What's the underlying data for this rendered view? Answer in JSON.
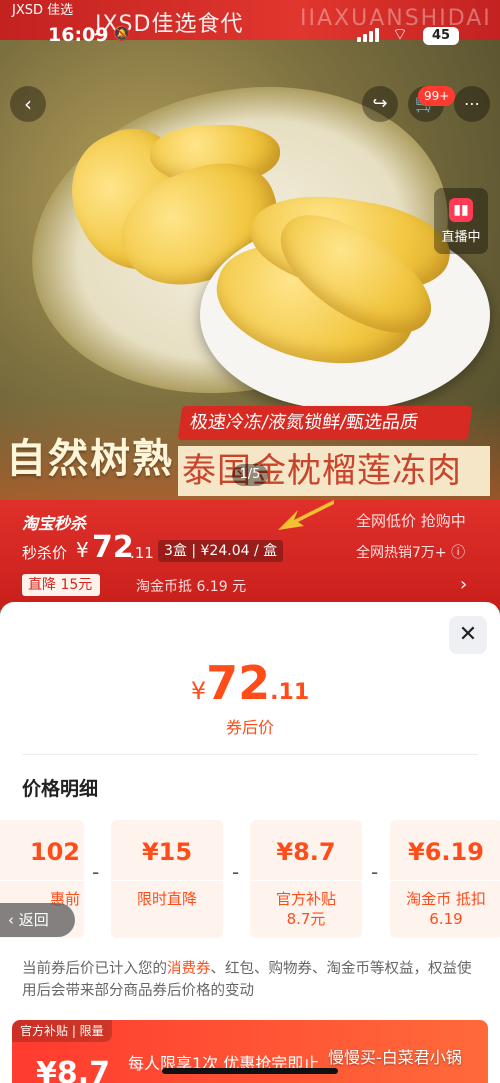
{
  "status_bar": {
    "time": "16:09",
    "battery": "45"
  },
  "hero": {
    "brand_badge": "JXSD 佳选",
    "brand_title": "JXSD佳选食代",
    "brand_faded": "IIAXUANSHIDAI",
    "cart_count": "99+",
    "live_label": "直播中",
    "promo_strip": "极速冷冻/液氮锁鲜/甄选品质",
    "promo_left": "自然树熟",
    "promo_right": "泰国金枕榴莲冻肉",
    "pager": "1/5"
  },
  "price_band": {
    "logo": "淘宝秒杀",
    "tagline": "全网低价 抢购中",
    "sale_label": "秒杀价",
    "currency": "¥",
    "price_int": "72",
    "price_dec": ".11",
    "per_unit": "3盒 | ¥24.04 / 盒",
    "sales": "全网热销7万+ ⓘ",
    "drop_badge": "直降 15元",
    "coin_text": "淘金币抵 6.19 元"
  },
  "sheet": {
    "currency": "¥",
    "price_int": "72",
    "price_dec": ".11",
    "after_label": "券后价",
    "section_title": "价格明细",
    "cards": [
      {
        "amount": "102",
        "label": "惠前"
      },
      {
        "amount": "¥15",
        "label": "限时直降"
      },
      {
        "amount": "¥8.7",
        "label": "官方补贴 8.7元"
      },
      {
        "amount": "¥6.19",
        "label": "淘金币 抵扣6.19"
      }
    ],
    "note_pre": "当前券后价已计入您的",
    "note_hl": "消费券",
    "note_post": "、红包、购物券、淘金币等权益，权益使用后会带来部分商品券后价格的变动",
    "coupon": {
      "tag": "官方补贴 | 限量",
      "value": "¥8.7",
      "text": "每人限享1次    优惠抢完即止"
    }
  },
  "back_label": "返回",
  "watermark": "慢慢买-白菜君小锅",
  "colors": {
    "accent": "#ff4d1a",
    "band": "#d62a22"
  }
}
